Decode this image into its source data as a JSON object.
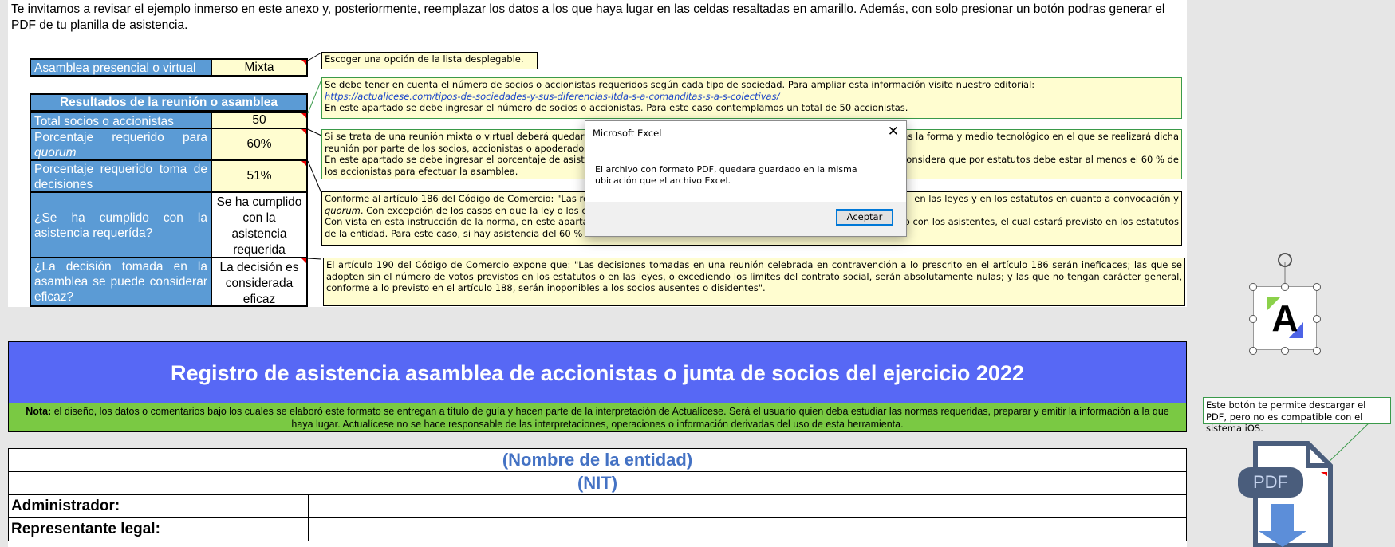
{
  "intro": "Te invitamos a revisar el ejemplo inmerso en este anexo y, posteriormente, reemplazar los datos a los que haya lugar en las celdas resaltadas en amarillo. Además, con solo presionar un botón podras generar el PDF de tu planilla de asistencia.",
  "form": {
    "modality_label": "Asamblea presencial o virtual",
    "modality_value": "Mixta",
    "results_header": "Resultados de la reunión o asamblea",
    "total_label": "Total socios o accionistas",
    "total_value": "50",
    "quorum_label_1": "Porcentaje requerido para",
    "quorum_label_2": "quorum",
    "quorum_value": "60%",
    "decision_pct_label_1": "Porcentaje requerido toma de",
    "decision_pct_label_2": "decisiones",
    "decision_pct_value": "51%",
    "attendance_label": "¿Se ha cumplido con la asistencia requerída?",
    "attendance_value": "Se ha cumplido con la asistencia requerida",
    "effective_label": "¿La decisión tomada en la asamblea se puede considerar eficaz?",
    "effective_value": "La decisión es considerada eficaz"
  },
  "notes": {
    "n1": "Escoger una opción de la lista desplegable.",
    "n2_a": "Se debe tener en cuenta el número de socios o accionistas requeridos según cada tipo de sociedad. Para ampliar esta información visite nuestro editorial:",
    "n2_link": "https://actualicese.com/tipos-de-sociedades-y-sus-diferencias-ltda-s-a-comanditas-s-a-s-colectivas/",
    "n2_b": "En este apartado se debe ingresar el número de socios o accionistas. Para este caso contemplamos un total de 50 accionistas.",
    "n3_a": "Si se trata de una reunión mixta o virtual deberá quedar res",
    "n3_a_right": "as la forma y medio tecnológico en el que se realizará dicha",
    "n3_b": "reunión por parte de los socios, accionistas o apoderados.",
    "n3_c": "En este apartado se debe ingresar el porcentaje de asistenc",
    "n3_c_right": "considera que por estatutos debe estar al menos el 60 % de",
    "n3_d": "los accionistas para efectuar la asamblea.",
    "n4_a": "Conforme al artículo 186 del Código de Comercio: \"Las reuni",
    "n4_a_right": "en las leyes y en los estatutos en cuanto a convocación y",
    "n4_b_italic": "quorum",
    "n4_b": ". Con excepción de los casos en que la ley o los esta",
    "n4_c": "Con vista en esta instrucción de la norma, en este apartado",
    "n4_c_right": "rdo con los asistentes, el cual estará previsto en los estatutos",
    "n4_d": "de la entidad. Para este caso, si hay asistencia del 60 % de",
    "n5": "El artículo 190 del Código de Comercio expone que: \"Las decisiones tomadas en una reunión celebrada en contravención a lo prescrito en el artículo 186 serán ineficaces; las que se adopten sin el número de votos previstos en los estatutos o en las leyes, o excediendo los límites del contrato social, serán absolutamente nulas; y las que no tengan carácter general, conforme a lo previsto en el artículo 188, serán inoponibles a los socios ausentes o disidentes\"."
  },
  "dialog": {
    "title": "Microsoft Excel",
    "message": "El archivo con formato PDF, quedara guardado en la misma ubicación que el archivo Excel.",
    "ok_label": "Aceptar"
  },
  "banner_title": "Registro de asistencia asamblea de accionistas o junta de socios del ejercicio 2022",
  "disclaimer_bold": "Nota:",
  "disclaimer": " el diseño, los datos o comentarios bajo los cuales se elaboró este formato se entregan a título de guía y hacen parte de la interpretación de Actualícese. Será el usuario quien deba estudiar las normas requeridas, preparar y emitir la información a la que haya lugar. Actualícese no se hace responsable de las interpretaciones, operaciones o información derivadas del uso de esta herramienta.",
  "entity_name": "(Nombre de la entidad)",
  "nit": "(NIT)",
  "admin_label": "Administrador:",
  "legal_rep_label": "Representante legal:",
  "logo_letter": "A",
  "pdf_button_label": "PDF",
  "pdf_note": "Este botón te permite descargar el PDF, pero no es compatible con el sistema iOS."
}
